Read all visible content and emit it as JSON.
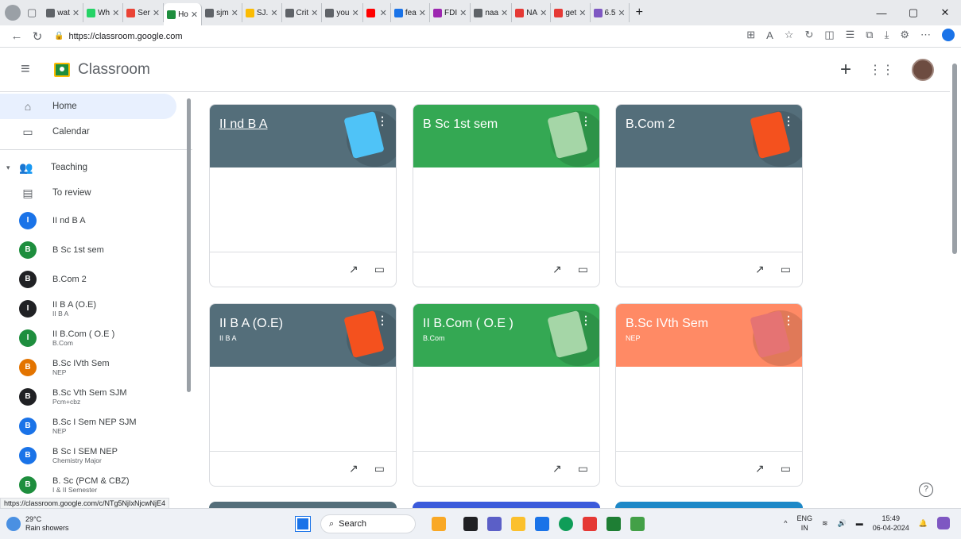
{
  "browser": {
    "tabs": [
      {
        "label": "wat",
        "color": "#5f6368"
      },
      {
        "label": "Wh",
        "color": "#25d366"
      },
      {
        "label": "Ser",
        "color": "#ea4335"
      },
      {
        "label": "Ho",
        "color": "#1e8e3e",
        "active": true
      },
      {
        "label": "sjm",
        "color": "#5f6368"
      },
      {
        "label": "SJ.",
        "color": "#fbbc04"
      },
      {
        "label": "Crit",
        "color": "#5f6368"
      },
      {
        "label": "you",
        "color": "#5f6368"
      },
      {
        "label": "",
        "color": "#ff0000"
      },
      {
        "label": "fea",
        "color": "#1a73e8"
      },
      {
        "label": "FDI",
        "color": "#9c27b0"
      },
      {
        "label": "naa",
        "color": "#5f6368"
      },
      {
        "label": "NA",
        "color": "#e53935"
      },
      {
        "label": "get",
        "color": "#e53935"
      },
      {
        "label": "6.5",
        "color": "#7e57c2"
      }
    ],
    "new_tab": "+",
    "url": "https://classroom.google.com",
    "status_url": "https://classroom.google.com/c/NTg5NjIxNjcwNjE4"
  },
  "header": {
    "title": "Classroom"
  },
  "sidebar": {
    "home": "Home",
    "calendar": "Calendar",
    "teaching": "Teaching",
    "to_review": "To review",
    "classes": [
      {
        "initial": "I",
        "name": "II nd B A",
        "sub": "",
        "color": "#1a73e8"
      },
      {
        "initial": "B",
        "name": "B Sc 1st sem",
        "sub": "",
        "color": "#1e8e3e"
      },
      {
        "initial": "B",
        "name": "B.Com 2",
        "sub": "",
        "color": "#202124"
      },
      {
        "initial": "I",
        "name": "II B A (O.E)",
        "sub": "II B A",
        "color": "#202124"
      },
      {
        "initial": "I",
        "name": "II B.Com ( O.E )",
        "sub": "B.Com",
        "color": "#1e8e3e"
      },
      {
        "initial": "B",
        "name": "B.Sc IVth Sem",
        "sub": "NEP",
        "color": "#e37400"
      },
      {
        "initial": "B",
        "name": "B.Sc Vth Sem SJM",
        "sub": "Pcm+cbz",
        "color": "#202124"
      },
      {
        "initial": "B",
        "name": "B.Sc I Sem NEP SJM",
        "sub": "NEP",
        "color": "#1a73e8"
      },
      {
        "initial": "B",
        "name": "B Sc I SEM NEP",
        "sub": "Chemistry Major",
        "color": "#1a73e8"
      },
      {
        "initial": "B",
        "name": "B. Sc (PCM & CBZ)",
        "sub": "I & II Semester",
        "color": "#1e8e3e"
      }
    ]
  },
  "cards": [
    {
      "title": "II nd B A",
      "section": "",
      "color": "#546e7a",
      "underline": true,
      "deco": "#4fc3f7"
    },
    {
      "title": "B Sc 1st sem",
      "section": "",
      "color": "#34a853",
      "underline": false,
      "deco": "#a5d6a7"
    },
    {
      "title": "B.Com 2",
      "section": "",
      "color": "#546e7a",
      "underline": false,
      "deco": "#f4511e"
    },
    {
      "title": "II B A (O.E)",
      "section": "II B A",
      "color": "#546e7a",
      "underline": false,
      "deco": "#f4511e"
    },
    {
      "title": "II B.Com ( O.E )",
      "section": "B.Com",
      "color": "#34a853",
      "underline": false,
      "deco": "#a5d6a7"
    },
    {
      "title": "B.Sc IVth Sem",
      "section": "NEP",
      "color": "#ff8a65",
      "underline": false,
      "deco": "#e57373"
    }
  ],
  "taskbar": {
    "temp": "29°C",
    "weather": "Rain showers",
    "search": "Search",
    "lang": "ENG",
    "region": "IN",
    "time": "15:49",
    "date": "06-04-2024"
  }
}
